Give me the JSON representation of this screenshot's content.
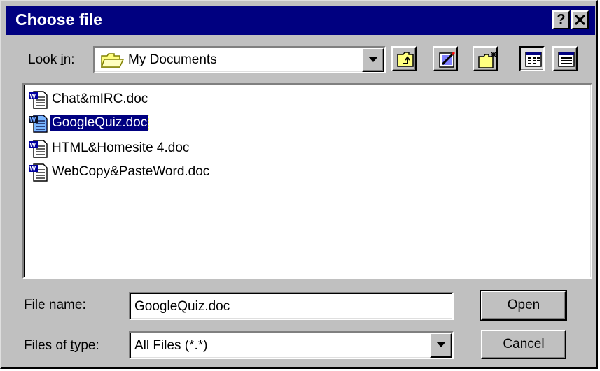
{
  "window": {
    "title": "Choose file",
    "help_label": "?",
    "close_label": "✕"
  },
  "lookin": {
    "label_pre": "Look ",
    "label_key": "i",
    "label_post": "n:",
    "value": "My Documents"
  },
  "toolbar": {
    "icons": [
      "up-folder-icon",
      "desktop-icon",
      "new-folder-icon",
      "list-view-icon",
      "details-view-icon"
    ]
  },
  "files": [
    {
      "name": "Chat&mIRC.doc",
      "selected": false
    },
    {
      "name": "GoogleQuiz.doc",
      "selected": true
    },
    {
      "name": "HTML&Homesite 4.doc",
      "selected": false
    },
    {
      "name": "WebCopy&PasteWord.doc",
      "selected": false
    }
  ],
  "filename": {
    "label_pre": "File ",
    "label_key": "n",
    "label_post": "ame:",
    "value": "GoogleQuiz.doc"
  },
  "filetype": {
    "label_pre": "Files of ",
    "label_key": "t",
    "label_post": "ype:",
    "value": "All Files (*.*)"
  },
  "buttons": {
    "open_key": "O",
    "open_rest": "pen",
    "cancel": "Cancel"
  }
}
